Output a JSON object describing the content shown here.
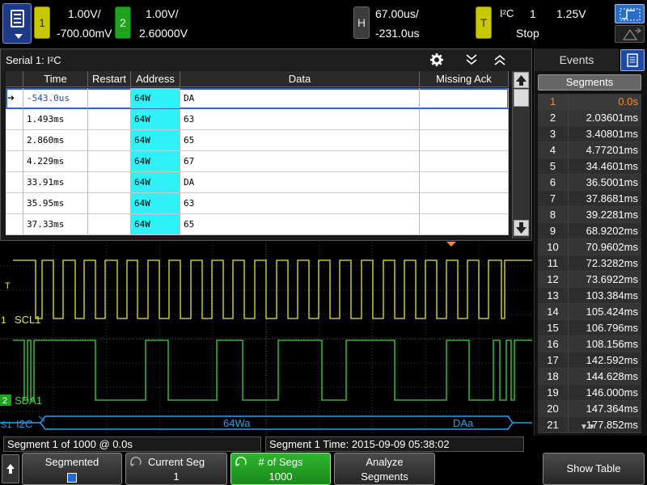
{
  "topbar": {
    "ch1": {
      "num": "1",
      "scale": "1.00V/",
      "offset": "-700.00mV"
    },
    "ch2": {
      "num": "2",
      "scale": "1.00V/",
      "offset": "2.60000V"
    },
    "horizontal": {
      "label": "H",
      "scale": "67.00us/",
      "delay": "-231.0us"
    },
    "trigger": {
      "label": "T",
      "type": "I²C",
      "source": "1",
      "level": "1.25V",
      "state": "Stop"
    }
  },
  "serial": {
    "title": "Serial 1: I²C",
    "columns": [
      "Time",
      "Restart",
      "Address",
      "Data",
      "Missing Ack"
    ],
    "rows": [
      {
        "time": "-543.0us",
        "restart": "",
        "address": "64W",
        "data": "DA",
        "ack": ""
      },
      {
        "time": "1.493ms",
        "restart": "",
        "address": "64W",
        "data": "63",
        "ack": ""
      },
      {
        "time": "2.860ms",
        "restart": "",
        "address": "64W",
        "data": "65",
        "ack": ""
      },
      {
        "time": "4.229ms",
        "restart": "",
        "address": "64W",
        "data": "67",
        "ack": ""
      },
      {
        "time": "33.91ms",
        "restart": "",
        "address": "64W",
        "data": "DA",
        "ack": ""
      },
      {
        "time": "35.95ms",
        "restart": "",
        "address": "64W",
        "data": "63",
        "ack": ""
      },
      {
        "time": "37.33ms",
        "restart": "",
        "address": "64W",
        "data": "65",
        "ack": ""
      }
    ]
  },
  "wave": {
    "scl_label": "SCL1",
    "sda_label": "SDA1",
    "bus_label": "I2C",
    "decode_addr": "64Wa",
    "decode_data": "DAa",
    "ch1_marker": "1",
    "ch2_marker": "2",
    "trig_marker": "T",
    "serial_marker": "S1",
    "colors": {
      "ch1": "#e8e832",
      "ch2": "#3fd83f",
      "bus": "#2a9ff0"
    }
  },
  "events": {
    "tab_label": "Events",
    "segments_label": "Segments",
    "segments": [
      {
        "n": "1",
        "t": "0.0s"
      },
      {
        "n": "2",
        "t": "2.03601ms"
      },
      {
        "n": "3",
        "t": "3.40801ms"
      },
      {
        "n": "4",
        "t": "4.77201ms"
      },
      {
        "n": "5",
        "t": "34.4601ms"
      },
      {
        "n": "6",
        "t": "36.5001ms"
      },
      {
        "n": "7",
        "t": "37.8681ms"
      },
      {
        "n": "8",
        "t": "39.2281ms"
      },
      {
        "n": "9",
        "t": "68.9202ms"
      },
      {
        "n": "10",
        "t": "70.9602ms"
      },
      {
        "n": "11",
        "t": "72.3282ms"
      },
      {
        "n": "12",
        "t": "73.6922ms"
      },
      {
        "n": "13",
        "t": "103.384ms"
      },
      {
        "n": "14",
        "t": "105.424ms"
      },
      {
        "n": "15",
        "t": "106.796ms"
      },
      {
        "n": "16",
        "t": "108.156ms"
      },
      {
        "n": "17",
        "t": "142.592ms"
      },
      {
        "n": "18",
        "t": "144.628ms"
      },
      {
        "n": "19",
        "t": "146.000ms"
      },
      {
        "n": "20",
        "t": "147.364ms"
      },
      {
        "n": "21",
        "t": "177.852ms"
      }
    ]
  },
  "status": {
    "left": "Segment 1 of 1000 @ 0.0s",
    "right": "Segment 1 Time: 2015-09-09 05:38:02"
  },
  "softkeys": {
    "segmented": {
      "l1": "Segmented"
    },
    "current_seg": {
      "l1": "Current Seg",
      "l2": "1"
    },
    "num_segs": {
      "l1": "# of Segs",
      "l2": "1000"
    },
    "analyze": {
      "l1": "Analyze",
      "l2": "Segments"
    },
    "show_table": {
      "l1": "Show Table"
    }
  }
}
